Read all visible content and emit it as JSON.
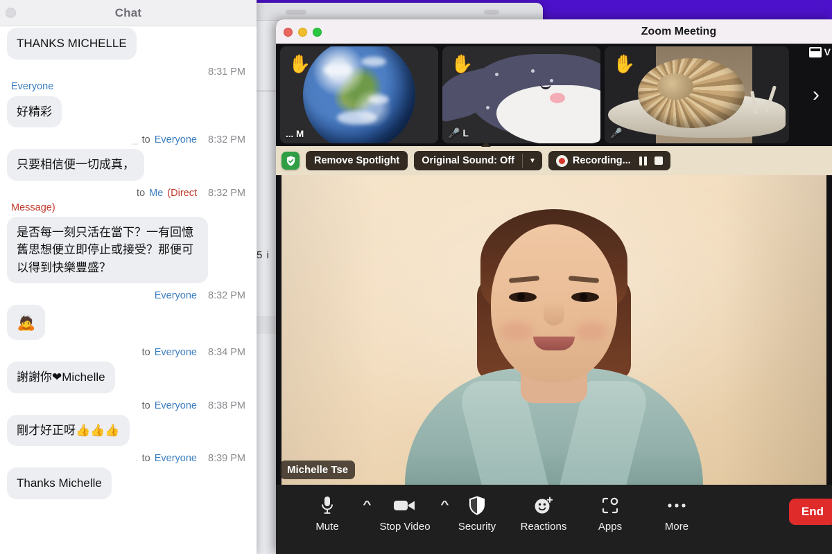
{
  "desktop": {
    "background_color": "#4b11c9",
    "background_window_color": "#e9eaee",
    "sliver_text": "5  i"
  },
  "chat_window": {
    "title": "Chat",
    "close_icon": "close-circle-icon",
    "messages": [
      {
        "sender": "",
        "to": "",
        "target": "",
        "time": "",
        "text": "THANKS MICHELLE",
        "align": "left",
        "show_meta": false
      },
      {
        "sender": "",
        "to": "",
        "target": "Everyone",
        "time": "8:31 PM",
        "text": "好精彩",
        "align": "left",
        "show_meta": true,
        "meta_align": "left"
      },
      {
        "sender": "_",
        "to": "to",
        "target": "Everyone",
        "time": "8:32 PM",
        "text": "只要相信便一切成真，",
        "align": "left",
        "show_meta": true,
        "meta_align": "right"
      },
      {
        "sender": "",
        "to": "to",
        "target": "Me",
        "dm_label": "(Direct",
        "dm_label_2": "Message)",
        "time": "8:32 PM",
        "text": "是否每一刻只活在當下？一有回憶舊思想便立即停止或接受？那便可以得到快樂豐盛？",
        "align": "left",
        "show_meta": true,
        "meta_align": "right",
        "is_dm": true
      },
      {
        "sender": "",
        "to": "",
        "target": "Everyone",
        "time": "8:32 PM",
        "text": "🙇",
        "align": "left",
        "show_meta": true,
        "meta_align": "right",
        "emoji_only": true
      },
      {
        "sender": "",
        "to": "to",
        "target": "Everyone",
        "time": "8:34 PM",
        "text": "謝謝你❤Michelle",
        "align": "left",
        "show_meta": true,
        "meta_align": "right"
      },
      {
        "sender": "",
        "to": "to",
        "target": "Everyone",
        "time": "8:38 PM",
        "text": "剛才好正呀👍👍👍",
        "align": "left",
        "show_meta": true,
        "meta_align": "right"
      },
      {
        "sender": ".",
        "to": "to",
        "target": "Everyone",
        "time": "8:39 PM",
        "text": "Thanks Michelle",
        "align": "left",
        "show_meta": true,
        "meta_align": "right"
      }
    ],
    "colors": {
      "bubble": "#eceef2",
      "target_link": "#3d7ebf",
      "direct_message": "#c0392b",
      "timestamp": "#8b8b90"
    }
  },
  "zoom_window": {
    "title": "Zoom Meeting",
    "traffic_lights": {
      "close": "close-button",
      "minimize": "minimize-button",
      "maximize": "maximize-button",
      "close_color": "#e9665d",
      "minimize_color": "#f0bd2c",
      "maximize_color": "#29c63f"
    },
    "filmstrip": {
      "thumbnails": [
        {
          "name": "... M",
          "hand_raised": true,
          "muted": false,
          "avatar": "earth-photo"
        },
        {
          "name": "L",
          "hand_raised": true,
          "muted": true,
          "avatar": "whale-illustration"
        },
        {
          "name": "",
          "hand_raised": true,
          "muted": true,
          "avatar": "snail-photo"
        }
      ],
      "view_label": "V",
      "view_icon": "gallery-view-icon",
      "next_page_icon": "chevron-right-icon"
    },
    "control_bar": {
      "shield_icon": "encryption-shield-icon",
      "remove_spotlight_label": "Remove Spotlight",
      "original_sound_label": "Original Sound: Off",
      "original_sound_caret": "chevron-down-icon",
      "recording_label": "Recording...",
      "recording_dot_color": "#d8372c",
      "pause_icon": "pause-icon",
      "stop_icon": "stop-icon"
    },
    "stage": {
      "participant_name": "Michelle Tse",
      "wall_color": "#f2dcbd",
      "shirt_color": "#93b0aa"
    },
    "toolbar": {
      "items": [
        {
          "label": "Mute",
          "icon": "microphone-icon",
          "has_chevron": true
        },
        {
          "label": "Stop Video",
          "icon": "video-camera-icon",
          "has_chevron": true
        },
        {
          "label": "Security",
          "icon": "shield-icon",
          "has_chevron": false
        },
        {
          "label": "Reactions",
          "icon": "smiley-plus-icon",
          "has_chevron": false
        },
        {
          "label": "Apps",
          "icon": "apps-icon",
          "has_chevron": false
        },
        {
          "label": "More",
          "icon": "ellipsis-icon",
          "has_chevron": false
        }
      ],
      "end_label": "End",
      "end_color": "#e02b2b"
    }
  }
}
